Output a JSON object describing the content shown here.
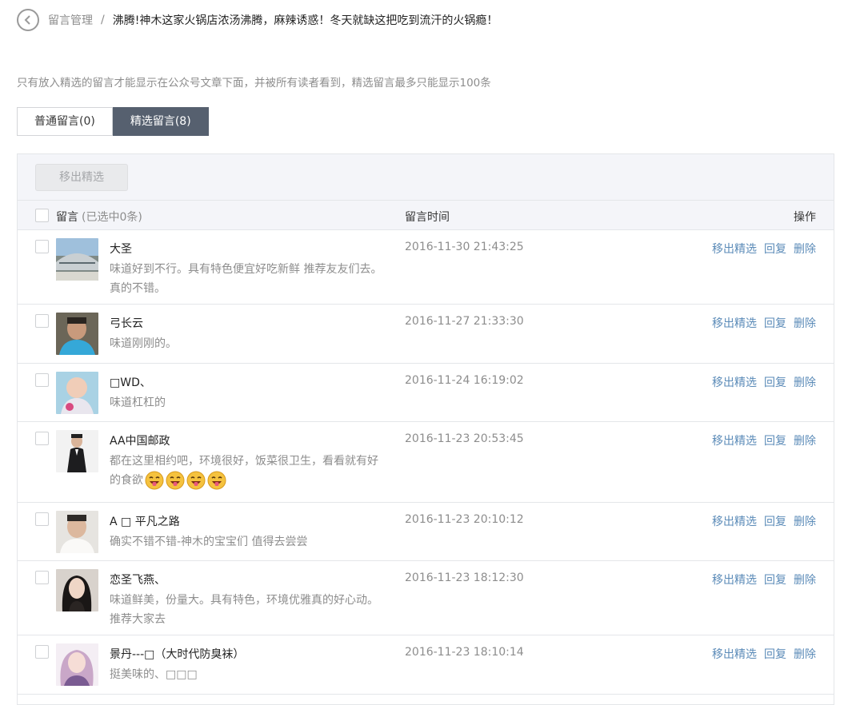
{
  "breadcrumb": {
    "root": "留言管理",
    "separator": "/",
    "current": "沸腾!神木这家火锅店浓汤沸腾，麻辣诱惑！冬天就缺这把吃到流汗的火锅瘾！"
  },
  "notice": "只有放入精选的留言才能显示在公众号文章下面，并被所有读者看到，精选留言最多只能显示100条",
  "tabs": [
    {
      "label": "普通留言(0)",
      "active": false
    },
    {
      "label": "精选留言(8)",
      "active": true
    }
  ],
  "toolbar": {
    "remove_label": "移出精选"
  },
  "table": {
    "col_message": "留言",
    "col_message_count": "(已选中0条)",
    "col_time": "留言时间",
    "col_ops": "操作"
  },
  "actions": {
    "remove": "移出精选",
    "reply": "回复",
    "delete": "删除"
  },
  "rows": [
    {
      "nickname": "大圣",
      "content": "味道好到不行。具有特色便宜好吃新鲜 推荐友友们去。真的不错。",
      "time": "2016-11-30 21:43:25",
      "avatar": "stadium"
    },
    {
      "nickname": "弓长云",
      "content": "味道刚刚的。",
      "time": "2016-11-27 21:33:30",
      "avatar": "man-blue-shirt"
    },
    {
      "nickname": "□WD、",
      "content": "味道杠杠的",
      "time": "2016-11-24 16:19:02",
      "avatar": "baby"
    },
    {
      "nickname": "AA中国邮政",
      "content": "都在这里相约吧，环境很好，饭菜很卫生，看看就有好的食欲",
      "emoji_count": 4,
      "emoji": "drooling-face",
      "time": "2016-11-23 20:53:45",
      "avatar": "man-suit"
    },
    {
      "nickname": "A □ 平凡之路",
      "content": "确实不错不错-神木的宝宝们 值得去尝尝",
      "time": "2016-11-23 20:10:12",
      "avatar": "man-white-shirt"
    },
    {
      "nickname": "恋圣飞燕、",
      "content": "味道鲜美，份量大。具有特色，环境优雅真的好心动。推荐大家去",
      "time": "2016-11-23 18:12:30",
      "avatar": "woman-dark-hair"
    },
    {
      "nickname": "景丹---□（大时代防臭袜）",
      "content": "挺美味的、□□□",
      "time": "2016-11-23 18:10:14",
      "avatar": "woman-pink"
    }
  ]
}
